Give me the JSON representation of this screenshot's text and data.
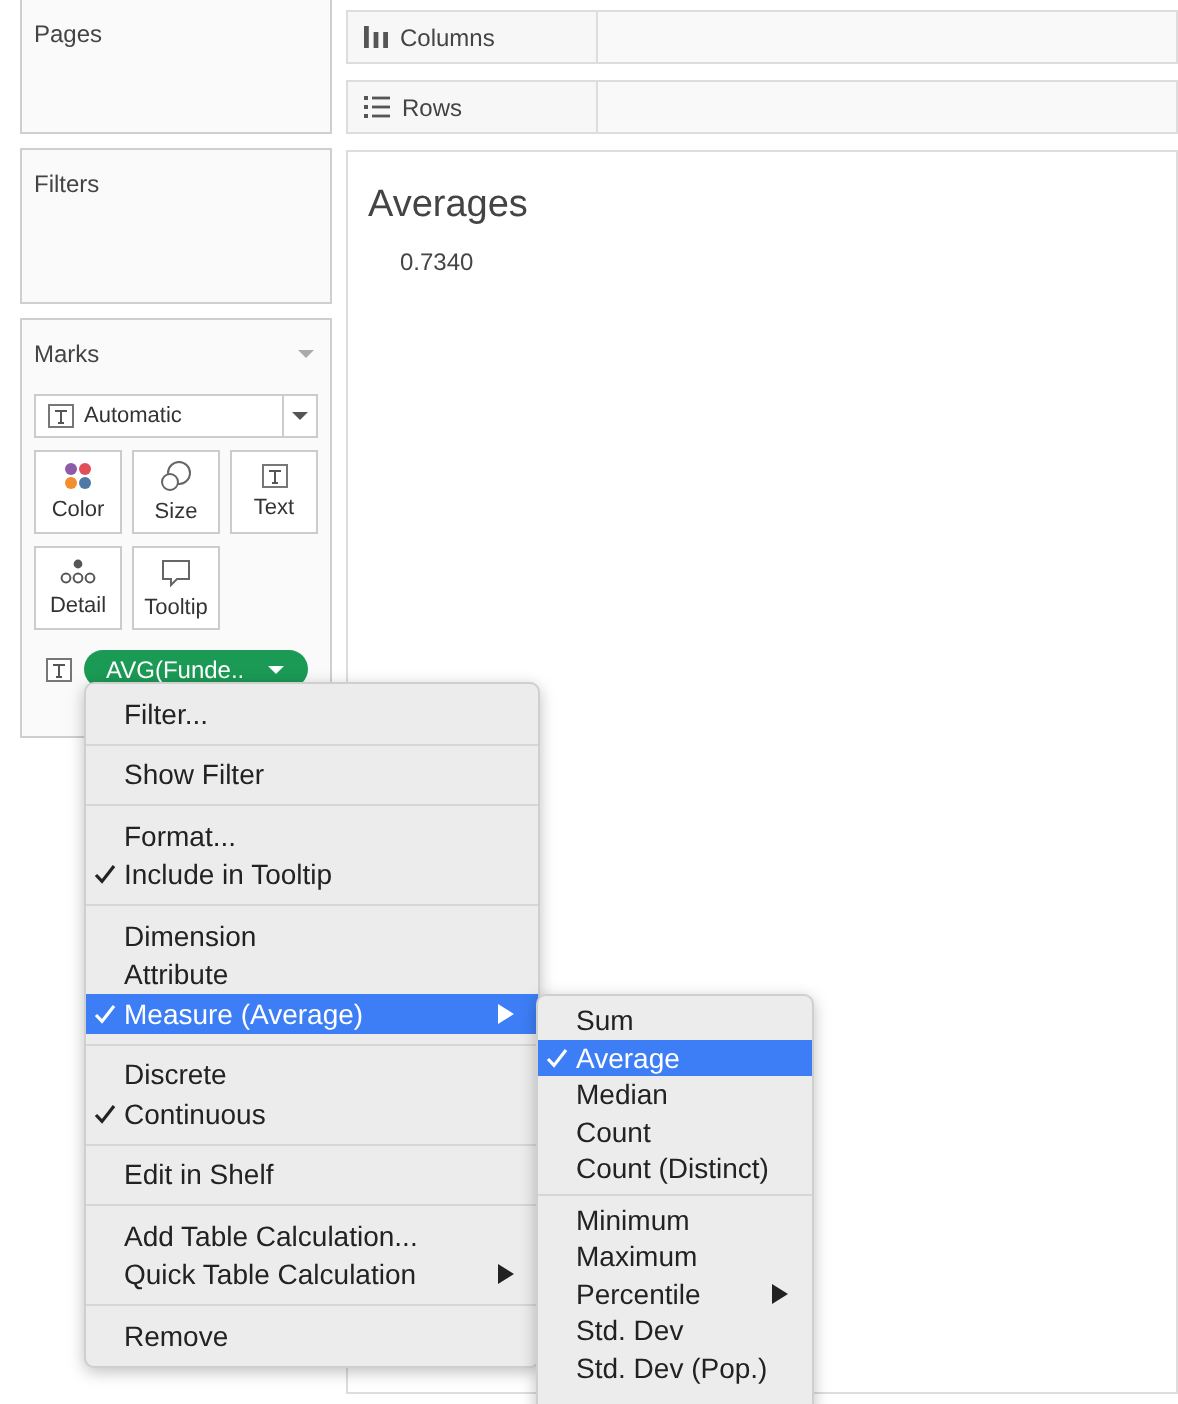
{
  "pages": {
    "title": "Pages"
  },
  "filters": {
    "title": "Filters"
  },
  "marks": {
    "title": "Marks",
    "mark_type": "Automatic",
    "cards": [
      {
        "label": "Color",
        "kind": "color"
      },
      {
        "label": "Size",
        "kind": "size"
      },
      {
        "label": "Text",
        "kind": "text"
      },
      {
        "label": "Detail",
        "kind": "detail"
      },
      {
        "label": "Tooltip",
        "kind": "tooltip"
      }
    ],
    "pill": {
      "label": "AVG(Funde..",
      "kind": "text"
    }
  },
  "columns_shelf": {
    "label": "Columns"
  },
  "rows_shelf": {
    "label": "Rows"
  },
  "view": {
    "title": "Averages",
    "value": "0.7340"
  },
  "context_menu": {
    "groups": [
      [
        {
          "label": "Filter...",
          "checked": false,
          "selected": false,
          "submenu": false
        }
      ],
      [
        {
          "label": "Show Filter",
          "checked": false,
          "selected": false,
          "submenu": false
        }
      ],
      [
        {
          "label": "Format...",
          "checked": false,
          "selected": false,
          "submenu": false
        },
        {
          "label": "Include in Tooltip",
          "checked": true,
          "selected": false,
          "submenu": false
        }
      ],
      [
        {
          "label": "Dimension",
          "checked": false,
          "selected": false,
          "submenu": false
        },
        {
          "label": "Attribute",
          "checked": false,
          "selected": false,
          "submenu": false
        },
        {
          "label": "Measure (Average)",
          "checked": true,
          "selected": true,
          "submenu": true
        }
      ],
      [
        {
          "label": "Discrete",
          "checked": false,
          "selected": false,
          "submenu": false
        },
        {
          "label": "Continuous",
          "checked": true,
          "selected": false,
          "submenu": false
        }
      ],
      [
        {
          "label": "Edit in Shelf",
          "checked": false,
          "selected": false,
          "submenu": false
        }
      ],
      [
        {
          "label": "Add Table Calculation...",
          "checked": false,
          "selected": false,
          "submenu": false
        },
        {
          "label": "Quick Table Calculation",
          "checked": false,
          "selected": false,
          "submenu": true
        }
      ],
      [
        {
          "label": "Remove",
          "checked": false,
          "selected": false,
          "submenu": false
        }
      ]
    ]
  },
  "submenu": {
    "groups": [
      [
        {
          "label": "Sum",
          "checked": false,
          "selected": false,
          "submenu": false
        },
        {
          "label": "Average",
          "checked": true,
          "selected": true,
          "submenu": false
        },
        {
          "label": "Median",
          "checked": false,
          "selected": false,
          "submenu": false
        },
        {
          "label": "Count",
          "checked": false,
          "selected": false,
          "submenu": false
        },
        {
          "label": "Count (Distinct)",
          "checked": false,
          "selected": false,
          "submenu": false
        }
      ],
      [
        {
          "label": "Minimum",
          "checked": false,
          "selected": false,
          "submenu": false
        },
        {
          "label": "Maximum",
          "checked": false,
          "selected": false,
          "submenu": false
        },
        {
          "label": "Percentile",
          "checked": false,
          "selected": false,
          "submenu": true
        },
        {
          "label": "Std. Dev",
          "checked": false,
          "selected": false,
          "submenu": false
        },
        {
          "label": "Std. Dev (Pop.)",
          "checked": false,
          "selected": false,
          "submenu": false
        }
      ]
    ]
  }
}
